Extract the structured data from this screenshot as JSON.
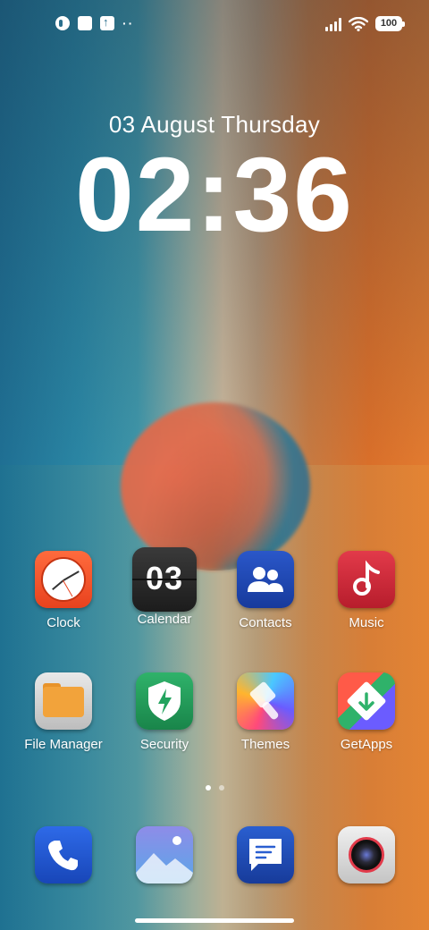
{
  "status_bar": {
    "notification_dots": "··",
    "battery": "100"
  },
  "lockscreen": {
    "date": "03 August Thursday",
    "time": "02:36"
  },
  "apps": [
    {
      "label": "Clock",
      "icon": "clock-icon"
    },
    {
      "label": "Calendar",
      "icon": "calendar-icon",
      "badge_text": "03"
    },
    {
      "label": "Contacts",
      "icon": "contacts-icon"
    },
    {
      "label": "Music",
      "icon": "music-icon"
    },
    {
      "label": "File Manager",
      "icon": "folder-icon"
    },
    {
      "label": "Security",
      "icon": "shield-icon"
    },
    {
      "label": "Themes",
      "icon": "paintbrush-icon"
    },
    {
      "label": "GetApps",
      "icon": "getapps-icon"
    }
  ],
  "dock": [
    {
      "icon": "phone-icon"
    },
    {
      "icon": "gallery-icon"
    },
    {
      "icon": "messages-icon"
    },
    {
      "icon": "camera-icon"
    }
  ],
  "pager": {
    "pages": 2,
    "active": 1
  },
  "colors": {
    "clock": "#e8421e",
    "contacts": "#2a57c9",
    "music": "#d02a3a",
    "security": "#2fb26a",
    "phone": "#2e6ae8"
  }
}
